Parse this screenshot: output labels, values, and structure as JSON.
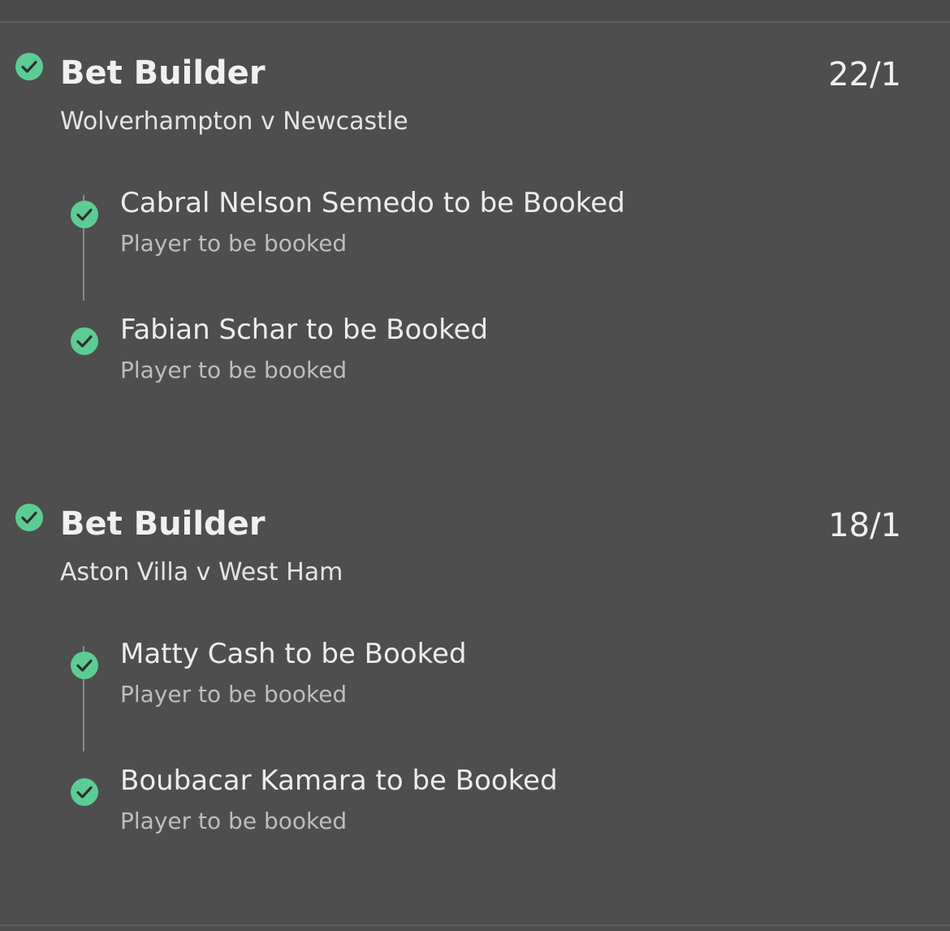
{
  "colors": {
    "accent": "#5ccc95",
    "background": "#4e4e4e"
  },
  "bets": [
    {
      "title": "Bet Builder",
      "odds": "22/1",
      "match": "Wolverhampton v Newcastle",
      "status_icon": "check-circle-icon",
      "legs": [
        {
          "title": "Cabral Nelson Semedo to be Booked",
          "market": "Player to be booked",
          "status_icon": "check-circle-icon"
        },
        {
          "title": "Fabian Schar to be Booked",
          "market": "Player to be booked",
          "status_icon": "check-circle-icon"
        }
      ]
    },
    {
      "title": "Bet Builder",
      "odds": "18/1",
      "match": "Aston Villa v West Ham",
      "status_icon": "check-circle-icon",
      "legs": [
        {
          "title": "Matty Cash to be Booked",
          "market": "Player to be booked",
          "status_icon": "check-circle-icon"
        },
        {
          "title": "Boubacar Kamara to be Booked",
          "market": "Player to be booked",
          "status_icon": "check-circle-icon"
        }
      ]
    }
  ]
}
